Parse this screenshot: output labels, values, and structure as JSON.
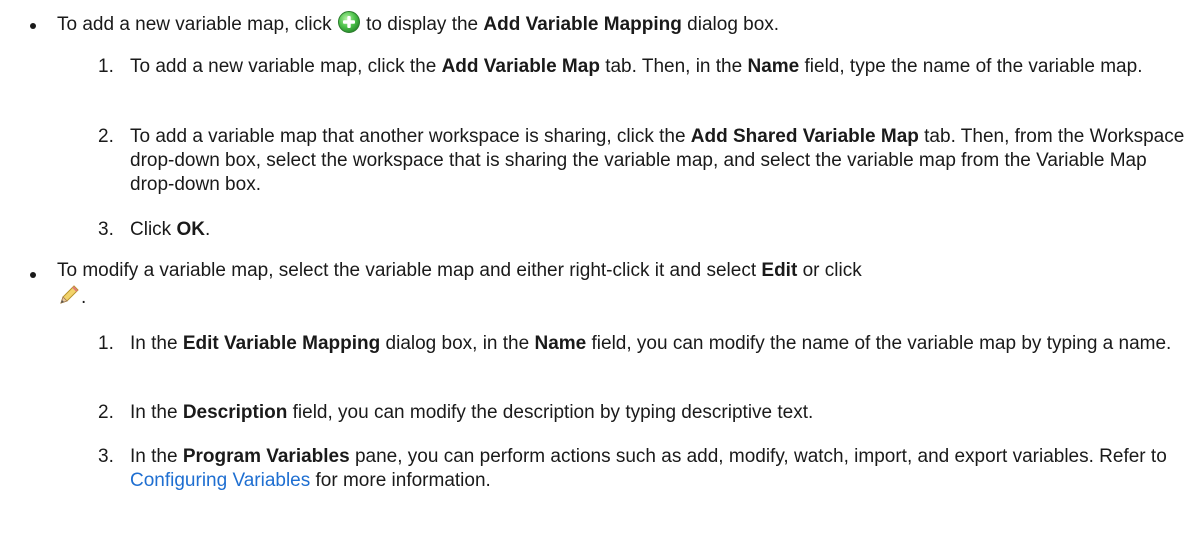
{
  "bullets": [
    {
      "pre": "To add a new variable map, click ",
      "icon": "add-green-plus-icon",
      "post_a": " to display the ",
      "bold_a": "Add Variable Mapping",
      "post_b": " dialog box.",
      "steps": [
        {
          "num": "1.",
          "t1": "To add a new variable map, click the ",
          "b1": "Add Variable Map",
          "t2": " tab. Then, in the ",
          "b2": "Name",
          "t3": " field, type the name of the variable map."
        },
        {
          "num": "2.",
          "t1": "To add a variable map that another workspace is sharing, click the ",
          "b1": "Add Shared Variable Map",
          "t2": " tab. Then, from the Workspace drop-down box, select the workspace that is sharing the variable map, and select the variable map from the Variable Map drop-down box."
        },
        {
          "num": "3.",
          "t1": "Click ",
          "b1": "OK",
          "t2": "."
        }
      ]
    },
    {
      "pre": "To modify a variable map, select the variable map and either right-click it and select ",
      "bold_a": "Edit",
      "post_a": " or click ",
      "icon": "pencil-edit-icon",
      "post_b": ".",
      "steps": [
        {
          "num": "1.",
          "t1": "In the ",
          "b1": "Edit Variable Mapping",
          "t2": " dialog box, in the ",
          "b2": "Name",
          "t3": " field, you can modify the name of the variable map by typing a name."
        },
        {
          "num": "2.",
          "t1": "In the ",
          "b1": "Description",
          "t2": " field, you can modify the description by typing descriptive text."
        },
        {
          "num": "3.",
          "t1": "In the ",
          "b1": "Program Variables",
          "t2": " pane, you can perform actions such as add, modify, watch, import, and  export variables. Refer to ",
          "link": "Configuring Variables",
          "t3": " for more information."
        }
      ]
    }
  ],
  "colors": {
    "text": "#1a1a1a",
    "link": "#1f6fd1",
    "add_icon": "#3cb043"
  }
}
